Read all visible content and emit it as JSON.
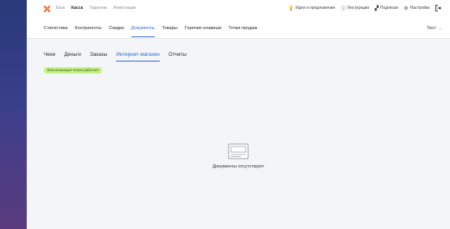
{
  "top_nav": {
    "items": [
      {
        "label": "Банк",
        "active": false
      },
      {
        "label": "Касса",
        "active": true
      },
      {
        "label": "Гарантии",
        "active": false
      },
      {
        "label": "Инвестиции",
        "active": false
      }
    ],
    "right": {
      "ideas": "Идеи и предложения",
      "instructions": "Инструкции",
      "subscriptions": "Подписки",
      "settings": "Настройки"
    }
  },
  "main_nav": {
    "items": [
      {
        "label": "Статистика"
      },
      {
        "label": "Контрагенты"
      },
      {
        "label": "Скидки"
      },
      {
        "label": "Документы"
      },
      {
        "label": "Товары"
      },
      {
        "label": "Горячие клавиши"
      },
      {
        "label": "Точки продаж"
      }
    ],
    "active_index": 3,
    "account": "Тест"
  },
  "doc_tabs": {
    "items": [
      {
        "label": "Чеки"
      },
      {
        "label": "Деньги"
      },
      {
        "label": "Заказы"
      },
      {
        "label": "Интернет-магазин"
      },
      {
        "label": "Отчеты"
      }
    ],
    "active_index": 3
  },
  "status_badge": "Фискализация чеков работает",
  "empty_state": {
    "text": "Документы отсутствуют",
    "icon": "document-placeholder-icon"
  },
  "colors": {
    "accent": "#2f66d8",
    "badge_bg": "#c6f283",
    "logo": "#f0642d",
    "background": "#f4f5f7"
  }
}
